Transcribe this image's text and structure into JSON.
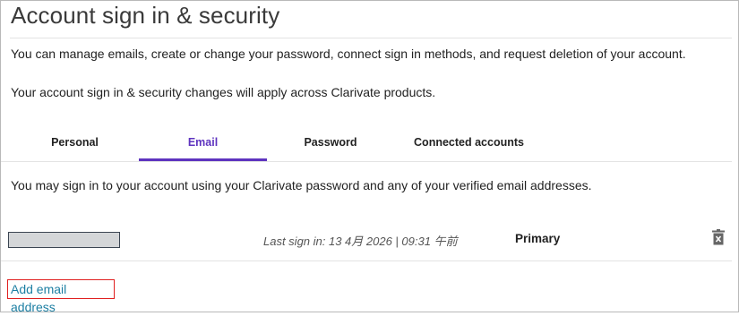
{
  "page": {
    "title": "Account sign in & security",
    "intro": "You can manage emails, create or change your password, connect sign in methods, and request deletion of your account.",
    "note": "Your account sign in & security changes will apply across Clarivate products."
  },
  "tabs": [
    {
      "label": "Personal",
      "active": false
    },
    {
      "label": "Email",
      "active": true
    },
    {
      "label": "Password",
      "active": false
    },
    {
      "label": "Connected accounts",
      "active": false
    }
  ],
  "email_section": {
    "description": "You may sign in to your account using your Clarivate password and any of your verified email addresses.",
    "emails": [
      {
        "address_redacted": true,
        "last_sign_in": "Last sign in: 13 4月 2026 | 09:31 午前",
        "status": "Primary"
      }
    ],
    "add_link": "Add email address"
  },
  "colors": {
    "accent": "#5e33bf",
    "link": "#1d7fa3",
    "highlight_border": "#e02020"
  },
  "icons": {
    "delete": "trash-icon"
  }
}
